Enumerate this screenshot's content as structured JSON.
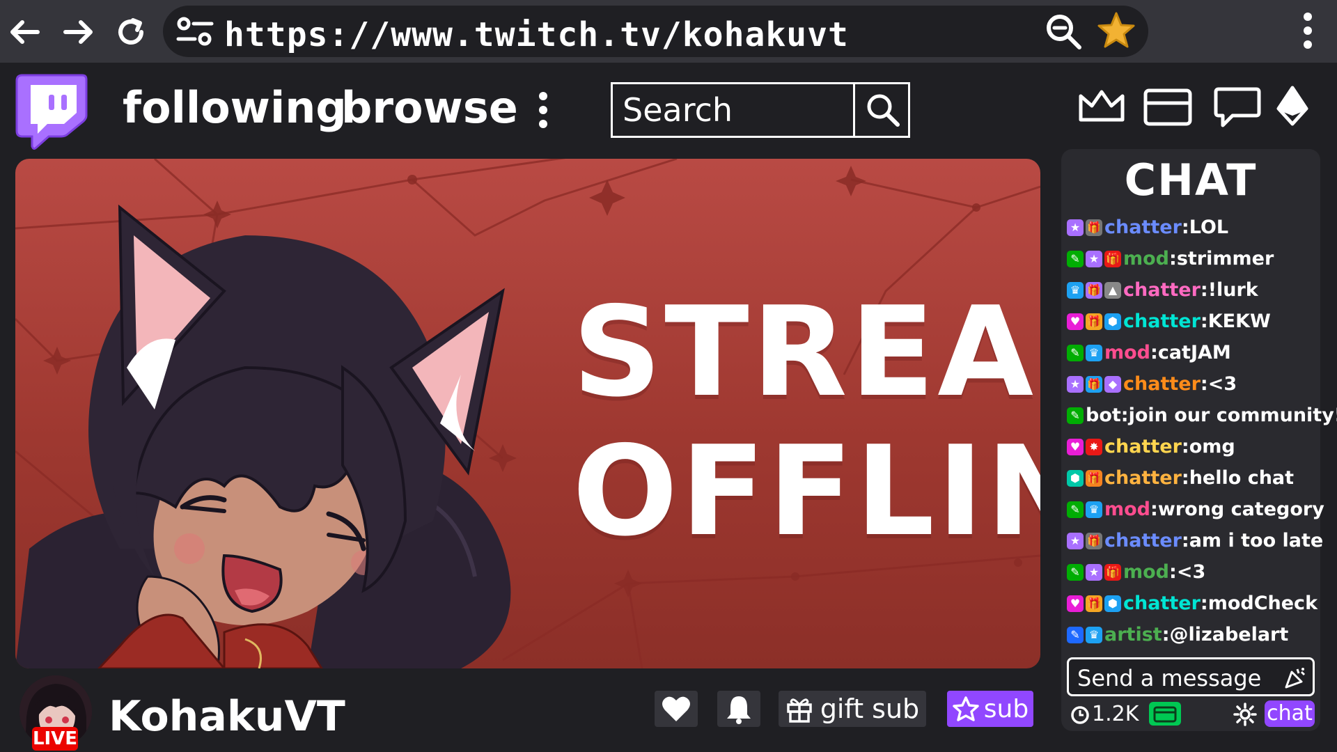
{
  "browser": {
    "url": "https://www.twitch.tv/kohakuvt",
    "back_icon": "arrow-left-icon",
    "forward_icon": "arrow-right-icon",
    "reload_icon": "reload-icon",
    "site_info_icon": "tune-icon",
    "zoom_icon": "zoom-out-icon",
    "bookmark_icon": "star-icon",
    "menu_icon": "kebab-menu-icon"
  },
  "nav": {
    "following_label": "following",
    "browse_label": "browse",
    "search_placeholder": "Search",
    "icons": [
      "crown-icon",
      "inbox-icon",
      "whisper-icon",
      "bits-icon"
    ]
  },
  "player": {
    "offline_line1": "STREAM",
    "offline_line2": "OFFLINE"
  },
  "channel": {
    "name": "KohakuVT",
    "live_label": "LIVE",
    "gift_sub_label": "gift sub",
    "sub_label": "sub"
  },
  "chat": {
    "title": "CHAT",
    "messages": [
      {
        "user": "chatter",
        "user_color": "#6b8cff",
        "text": "LOL",
        "badges": [
          [
            "#a970ff",
            "★"
          ],
          [
            "#777",
            "🎁"
          ]
        ]
      },
      {
        "user": "mod",
        "user_color": "#4caf50",
        "text": "strimmer",
        "badges": [
          [
            "#00ad03",
            "✎"
          ],
          [
            "#a970ff",
            "★"
          ],
          [
            "#e91916",
            "🎁"
          ]
        ]
      },
      {
        "user": "chatter",
        "user_color": "#ff6ac1",
        "text": "!lurk",
        "badges": [
          [
            "#1da1f2",
            "♛"
          ],
          [
            "#a970ff",
            "🎁"
          ],
          [
            "#888",
            "▲"
          ]
        ]
      },
      {
        "user": "chatter",
        "user_color": "#00e5d4",
        "text": "KEKW",
        "badges": [
          [
            "#e91ed6",
            "♥"
          ],
          [
            "#f5a623",
            "🎁"
          ],
          [
            "#1da1f2",
            "⬢"
          ]
        ]
      },
      {
        "user": "mod",
        "user_color": "#ff4d8f",
        "text": "catJAM",
        "badges": [
          [
            "#00ad03",
            "✎"
          ],
          [
            "#1da1f2",
            "♛"
          ]
        ]
      },
      {
        "user": "chatter",
        "user_color": "#ff8c1a",
        "text": "<3",
        "badges": [
          [
            "#a970ff",
            "★"
          ],
          [
            "#1da1f2",
            "🎁"
          ],
          [
            "#a970ff",
            "◆"
          ]
        ]
      },
      {
        "user": "bot",
        "user_color": "#ffffff",
        "text": "join our community!",
        "badges": [
          [
            "#00ad03",
            "✎"
          ]
        ]
      },
      {
        "user": "chatter",
        "user_color": "#ffd54f",
        "text": "omg",
        "badges": [
          [
            "#e91ed6",
            "♥"
          ],
          [
            "#e91916",
            "✸"
          ]
        ]
      },
      {
        "user": "chatter",
        "user_color": "#ffb340",
        "text": "hello chat",
        "badges": [
          [
            "#00c8a8",
            "⬢"
          ],
          [
            "#f58220",
            "🎁"
          ]
        ]
      },
      {
        "user": "mod",
        "user_color": "#ff4d8f",
        "text": "wrong category",
        "badges": [
          [
            "#00ad03",
            "✎"
          ],
          [
            "#1da1f2",
            "♛"
          ]
        ]
      },
      {
        "user": "chatter",
        "user_color": "#6b8cff",
        "text": "am i too late",
        "badges": [
          [
            "#a970ff",
            "★"
          ],
          [
            "#777",
            "🎁"
          ]
        ]
      },
      {
        "user": "mod",
        "user_color": "#4caf50",
        "text": "<3",
        "badges": [
          [
            "#00ad03",
            "✎"
          ],
          [
            "#a970ff",
            "★"
          ],
          [
            "#e91916",
            "🎁"
          ]
        ]
      },
      {
        "user": "chatter",
        "user_color": "#00e5d4",
        "text": "modCheck",
        "badges": [
          [
            "#e91ed6",
            "♥"
          ],
          [
            "#f5a623",
            "🎁"
          ],
          [
            "#1da1f2",
            "⬢"
          ]
        ]
      },
      {
        "user": "artist",
        "user_color": "#4caf50",
        "text": "@lizabelart",
        "badges": [
          [
            "#1e69ff",
            "✎"
          ],
          [
            "#1da1f2",
            "♛"
          ]
        ]
      }
    ],
    "input_placeholder": "Send a message",
    "viewer_count": "1.2K",
    "chat_button_label": "chat",
    "settings_icon": "gear-icon",
    "emote_icon": "emote-icon",
    "points_icon": "channel-points-icon"
  }
}
